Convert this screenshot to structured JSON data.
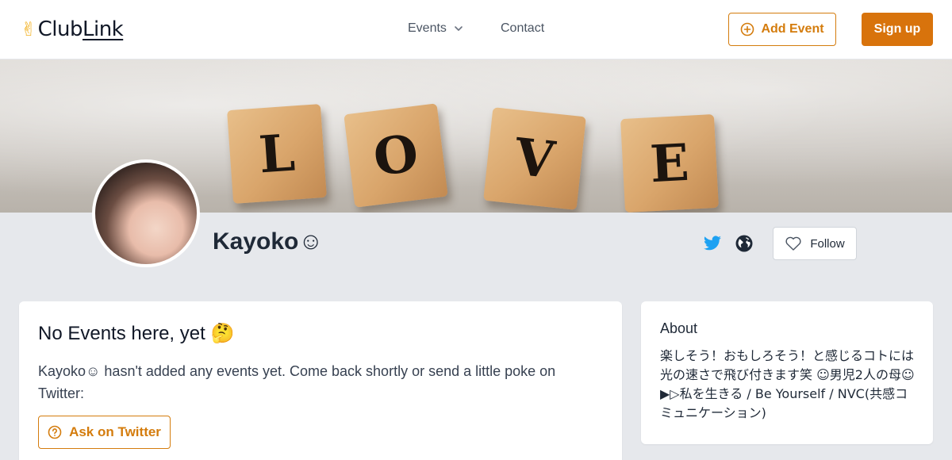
{
  "header": {
    "logo_emoji": "✌",
    "logo_text_plain": "Club",
    "logo_text_link": "Link",
    "nav": {
      "events_label": "Events",
      "contact_label": "Contact"
    },
    "add_event_label": "Add Event",
    "signup_label": "Sign up"
  },
  "banner": {
    "letters": [
      "L",
      "O",
      "V",
      "E"
    ]
  },
  "profile": {
    "name": "Kayoko☺",
    "follow_label": "Follow"
  },
  "events_card": {
    "title": "No Events here, yet 🤔",
    "message": "Kayoko☺ hasn't added any events yet. Come back shortly or send a little poke on Twitter:",
    "ask_button_label": "Ask on Twitter"
  },
  "about_card": {
    "title": "About",
    "text": "楽しそう！おもしろそう！と感じるコトには光の速さで飛び付きます笑 ☺男児2人の母☺ ▶▷私を生きる / Be Yourself / NVC(共感コミュニケーション)"
  },
  "colors": {
    "accent": "#d8730c",
    "twitter": "#1da1f2",
    "background": "#e6e8ec"
  },
  "icons": [
    "chevron-down-icon",
    "plus-circle-icon",
    "twitter-icon",
    "globe-icon",
    "heart-icon",
    "question-circle-icon"
  ]
}
